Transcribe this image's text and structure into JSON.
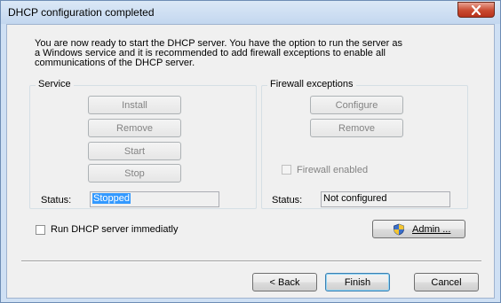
{
  "window": {
    "title": "DHCP configuration completed",
    "close_icon": "close-icon"
  },
  "intro": {
    "line1": "You are now ready to start the DHCP server. You have the option to run the server as",
    "line2": "a Windows service and it is recommended to add firewall exceptions to enable all",
    "line3": "communications of the DHCP server."
  },
  "service": {
    "legend": "Service",
    "install": "Install",
    "remove": "Remove",
    "start": "Start",
    "stop": "Stop",
    "status_label": "Status:",
    "status_value": "Stopped"
  },
  "firewall": {
    "legend": "Firewall exceptions",
    "configure": "Configure",
    "remove": "Remove",
    "enabled_label": "Firewall enabled",
    "status_label": "Status:",
    "status_value": "Not configured"
  },
  "run_immediately": {
    "label": "Run DHCP server immediatly",
    "checked": false
  },
  "admin_button": {
    "label": "Admin ...",
    "icon": "shield-icon"
  },
  "footer": {
    "back": "< Back",
    "finish": "Finish",
    "cancel": "Cancel"
  }
}
